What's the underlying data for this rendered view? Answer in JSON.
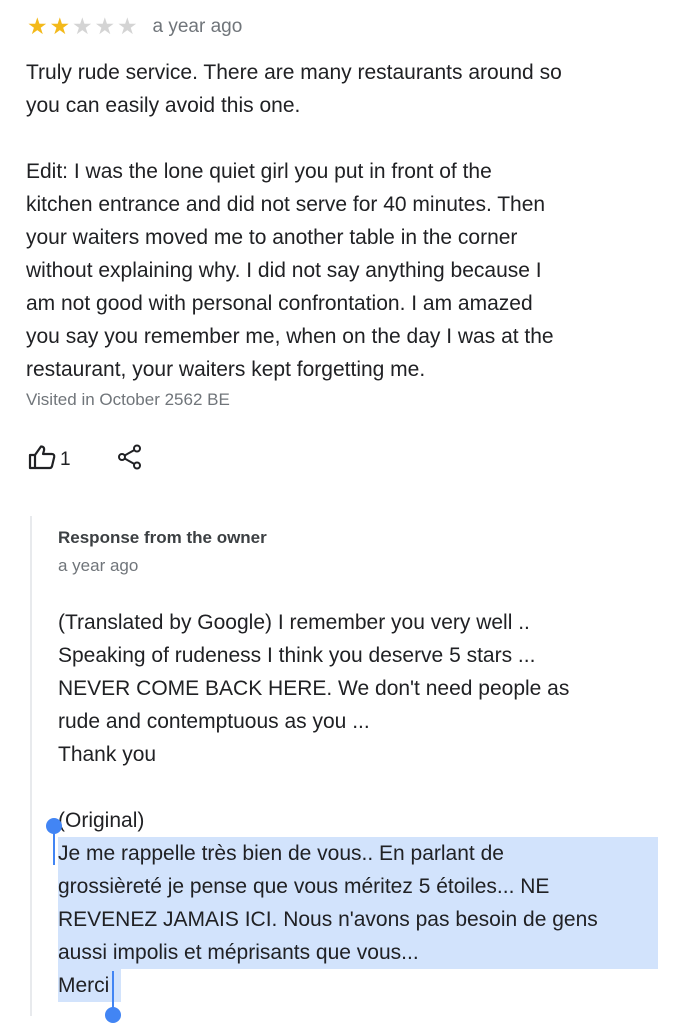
{
  "review": {
    "rating": 2,
    "max_rating": 5,
    "time": "a year ago",
    "text": "Truly rude service. There are many restaurants around so\nyou can easily avoid this one.\n\nEdit: I was the lone quiet girl you put in front of the\nkitchen entrance and did not serve for 40 minutes. Then\nyour waiters moved me to another table in the corner\nwithout explaining why. I did not say anything because I\nam not good with personal confrontation. I am amazed\nyou say you remember me, when on the day I was at the\nrestaurant, your waiters kept forgetting me.",
    "visited": "Visited in October 2562 BE",
    "like_count": "1",
    "icons": {
      "star_filled": "star-filled-icon",
      "star_empty": "star-empty-icon",
      "like": "thumbs-up-icon",
      "share": "share-icon"
    }
  },
  "owner_response": {
    "title": "Response from the owner",
    "time": "a year ago",
    "translated_text": "(Translated by Google) I remember you very well ..\nSpeaking of rudeness I think you deserve 5 stars ...\nNEVER COME BACK HERE. We don't need people as\nrude and contemptuous as you ...\nThank you",
    "original_label": "(Original)",
    "original_lines": [
      "Je me rappelle très bien de vous.. En parlant de",
      "grossièreté je pense que vous méritez 5 étoiles... NE",
      "REVENEZ JAMAIS ICI. Nous n'avons pas besoin de gens",
      "aussi impolis et méprisants que vous...",
      "Merci"
    ]
  },
  "colors": {
    "star_on": "#f3b91a",
    "star_off": "#d4d4d4",
    "selection": "#d2e3fc",
    "selection_handle": "#4285f4",
    "secondary_text": "#70757a"
  }
}
